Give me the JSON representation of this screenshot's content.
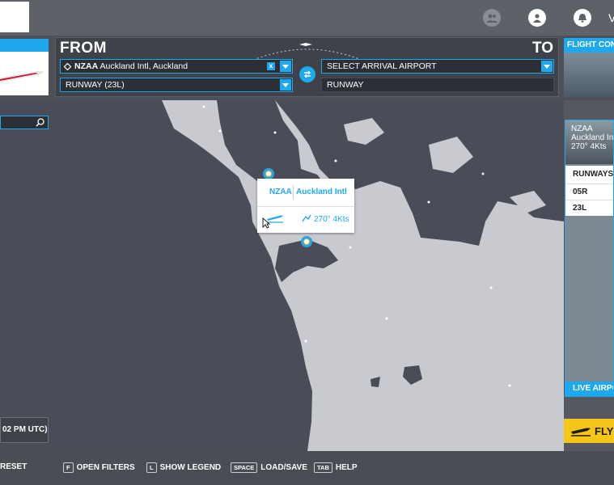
{
  "header": {
    "from_label": "FROM",
    "to_label": "TO",
    "departure": {
      "icao": "NZAA",
      "name": "Auckland Intl, Auckland",
      "clear_label": "x"
    },
    "departure_runway": "RUNWAY (23L)",
    "arrival_placeholder": "SELECT ARRIVAL AIRPORT",
    "arrival_runway": "RUNWAY"
  },
  "flight_conditions": {
    "label": "FLIGHT CONDITIONS"
  },
  "popup": {
    "icao": "NZAA",
    "name": "Auckland Intl",
    "wind": "270° 4Kts"
  },
  "right_panel": {
    "icao": "NZAA",
    "name": "Auckland Intl",
    "wind": "270° 4Kts",
    "runways_label": "RUNWAYS",
    "runways": [
      "05R",
      "23L"
    ],
    "live_label": "LIVE AIRPORT"
  },
  "time_text": "02 PM UTC)",
  "fly_label": "FLY",
  "bottom": [
    {
      "key": "",
      "label": "RESET"
    },
    {
      "key": "F",
      "label": "OPEN FILTERS"
    },
    {
      "key": "L",
      "label": "SHOW LEGEND"
    },
    {
      "key": "SPACE",
      "label": "LOAD/SAVE"
    },
    {
      "key": "TAB",
      "label": "HELP"
    }
  ],
  "topbar": {
    "v_text": "V"
  },
  "colors": {
    "accent": "#1ea8ee",
    "fly": "#f5c518",
    "sea": "#c9cad0",
    "land": "#4a4c57"
  }
}
